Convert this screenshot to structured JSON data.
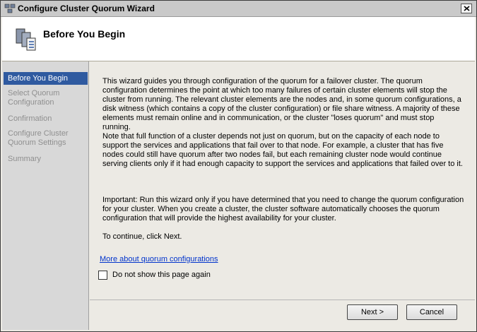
{
  "window": {
    "title": "Configure Cluster Quorum Wizard"
  },
  "header": {
    "heading": "Before You Begin"
  },
  "nav": {
    "items": [
      {
        "label": "Before You Begin",
        "active": true
      },
      {
        "label": "Select Quorum Configuration",
        "active": false
      },
      {
        "label": "Confirmation",
        "active": false
      },
      {
        "label": "Configure Cluster Quorum Settings",
        "active": false
      },
      {
        "label": "Summary",
        "active": false
      }
    ]
  },
  "content": {
    "paragraph1": "This wizard guides you through configuration of the quorum for a failover cluster. The quorum configuration determines the point at which too many failures of certain cluster elements will stop the cluster from running. The relevant cluster elements are the nodes and, in some quorum configurations, a disk witness (which contains a copy of the cluster configuration) or file share witness. A majority of these elements must remain online and in communication, or the cluster \"loses quorum\" and must stop running.",
    "paragraph2": "Note that full function of a cluster depends not just on quorum, but on the capacity of each node to support the services and applications that fail over to that node. For example, a cluster that has five nodes could still have quorum after two nodes fail, but each remaining cluster node would continue serving clients only if it had enough capacity to support the services and applications that failed over to it.",
    "paragraph3": "Important: Run this wizard only if you have determined that you need to change the quorum configuration for your cluster. When you create a cluster, the cluster software automatically chooses the quorum configuration that will provide the highest availability for your cluster.",
    "paragraph4": "To continue, click Next.",
    "link": "More about quorum configurations",
    "checkbox_label": "Do not show this page again",
    "checkbox_checked": false
  },
  "footer": {
    "next_label": "Next >",
    "cancel_label": "Cancel"
  }
}
